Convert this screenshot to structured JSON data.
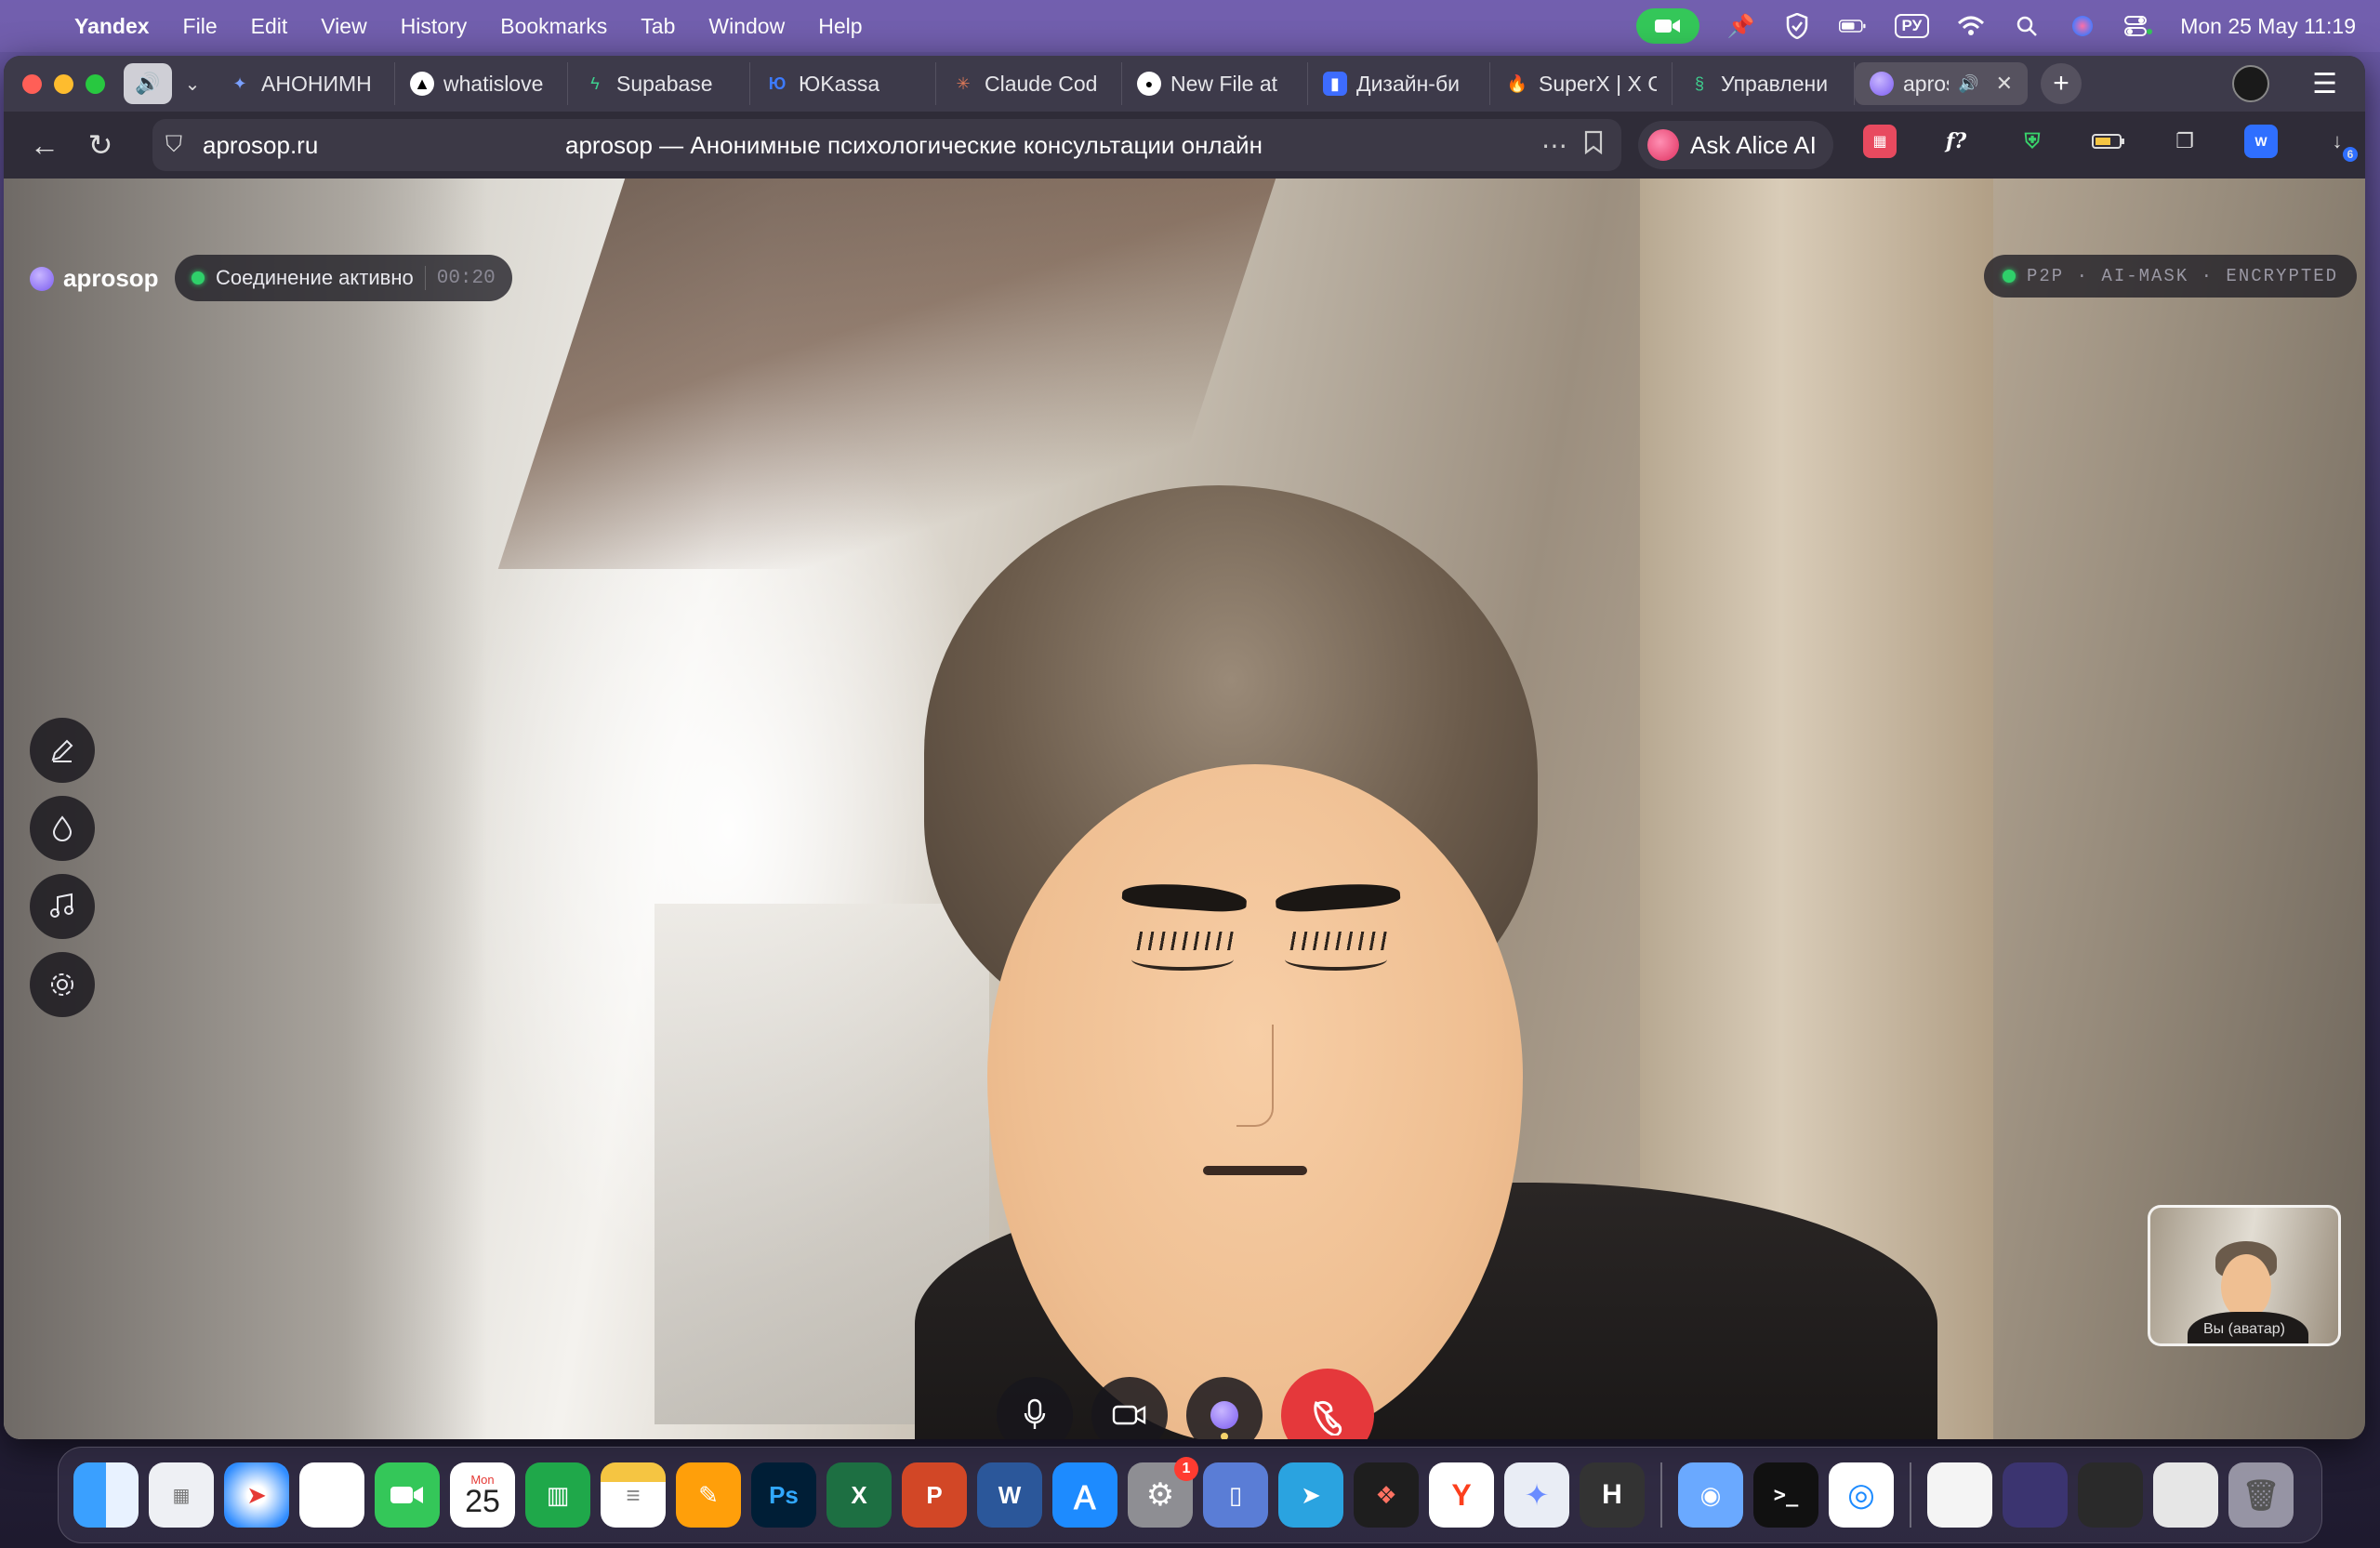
{
  "menubar": {
    "app": "Yandex",
    "items": [
      "File",
      "Edit",
      "View",
      "History",
      "Bookmarks",
      "Tab",
      "Window",
      "Help"
    ],
    "lang": "РУ",
    "clock": "Mon 25 May  11:19"
  },
  "tabs": [
    {
      "title": "АНОНИМН",
      "icon": "sparkle-icon"
    },
    {
      "title": "whatislove",
      "icon": "triangle-icon"
    },
    {
      "title": "Supabase",
      "icon": "bolt-icon"
    },
    {
      "title": "ЮKassa",
      "icon": "yookassa-icon"
    },
    {
      "title": "Claude Cod",
      "icon": "claude-icon"
    },
    {
      "title": "New File at",
      "icon": "github-icon"
    },
    {
      "title": "Дизайн-би",
      "icon": "bookmark-icon"
    },
    {
      "title": "SuperX | X C",
      "icon": "fire-icon"
    },
    {
      "title": "Управлени",
      "icon": "leaf-icon"
    },
    {
      "title": "aprosc",
      "icon": "aprosop-icon",
      "active": true
    }
  ],
  "address": {
    "domain": "aprosop.ru",
    "title": "aprosop — Анонимные психологические консультации онлайн"
  },
  "alice_label": "Ask Alice AI",
  "call": {
    "brand": "aprosop",
    "status": "Соединение активно",
    "timer": "00:20",
    "security": "P2P · AI-MASK · ENCRYPTED",
    "pip_label": "Вы (аватар)"
  },
  "dock": {
    "calendar_month": "Mon",
    "calendar_day": "25",
    "settings_badge": "1"
  }
}
